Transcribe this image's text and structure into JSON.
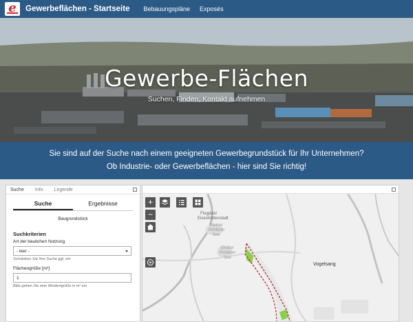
{
  "navbar": {
    "brand": "Gewerbeflächen - Startseite",
    "links": [
      "Bebauungspläne",
      "Exposés"
    ],
    "logo_letter": "e",
    "color": "#2c5a86"
  },
  "hero": {
    "title": "Gewerbe-Flächen",
    "subtitle": "Suchen, Finden, Kontakt aufnehmen"
  },
  "banner": {
    "line1": "Sie sind auf der Suche nach einem geeigneten Gewerbegrundstück für Ihr Unternehmen?",
    "line2": "Ob Industrie- oder Gewerbeflächen - hier sind Sie richtig!"
  },
  "panel": {
    "tabs": [
      "Suche",
      "Info",
      "Legende"
    ],
    "subtabs": [
      "Suche",
      "Ergebnisse"
    ],
    "type_label": "Baugrundstück",
    "section_title": "Suchkriterien",
    "usage_label": "Art der baulichen Nutzung",
    "usage_value": "- leer -",
    "usage_hint": "Schränken Sie Ihre Suche ggf. ein",
    "area_label": "Flächengröße [m²]",
    "area_value": "1",
    "area_hint": "Bitte geben Sie eine Mindestgröße in m² ein"
  },
  "map": {
    "place_label": "Vogelsang",
    "label_flugplatz_1": "Flugplatz",
    "label_flugplatz_2": "Eisenhüttenstadt",
    "label_lake_1a": "Kleiner",
    "label_lake_1b": "Pohlitzer",
    "label_lake_1c": "See",
    "label_lake_2a": "Großer",
    "label_lake_2b": "Pohlitzer",
    "label_lake_2c": "See",
    "icons": [
      "zoom-in",
      "layers",
      "list",
      "grid",
      "zoom-out",
      "home",
      "locate"
    ]
  }
}
